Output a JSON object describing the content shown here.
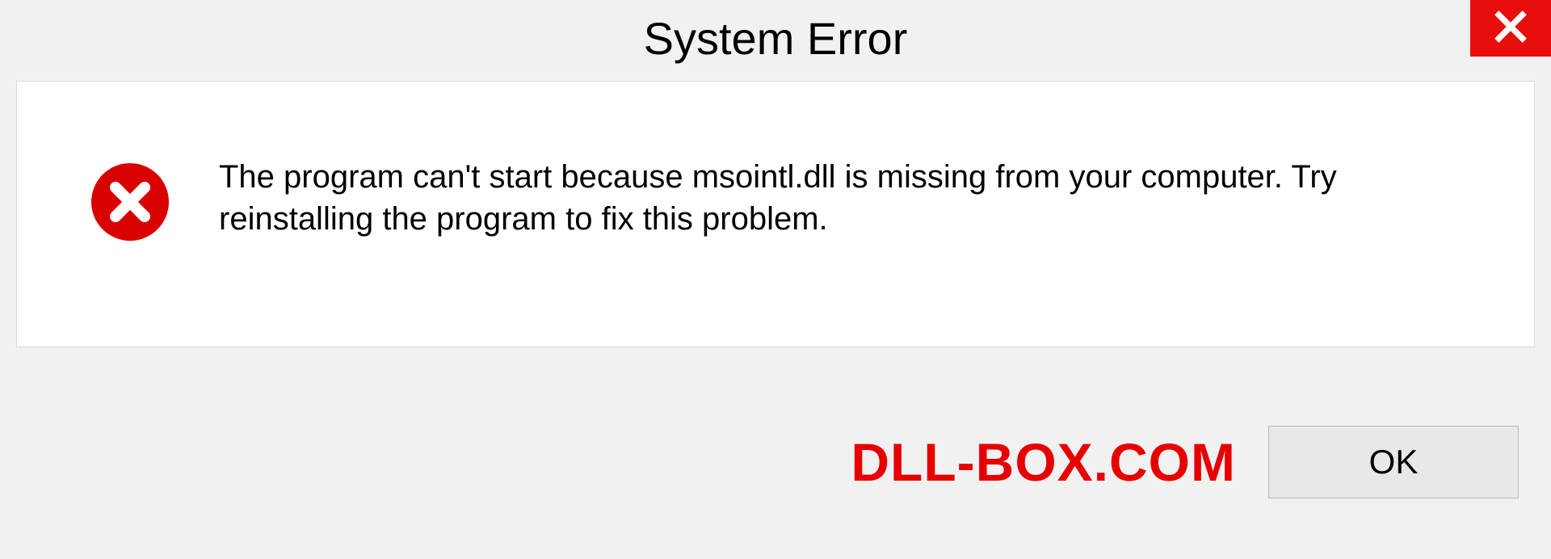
{
  "titlebar": {
    "title": "System Error"
  },
  "body": {
    "message": "The program can't start because msointl.dll is missing from your computer. Try reinstalling the program to fix this problem."
  },
  "footer": {
    "watermark": "DLL-BOX.COM",
    "ok_label": "OK"
  },
  "icons": {
    "close": "close-icon",
    "error": "error-circle-x-icon"
  },
  "colors": {
    "close_bg": "#e80e0e",
    "error_red": "#d90000",
    "watermark_red": "#e60000",
    "panel_bg": "#ffffff",
    "page_bg": "#f1f1f1"
  }
}
